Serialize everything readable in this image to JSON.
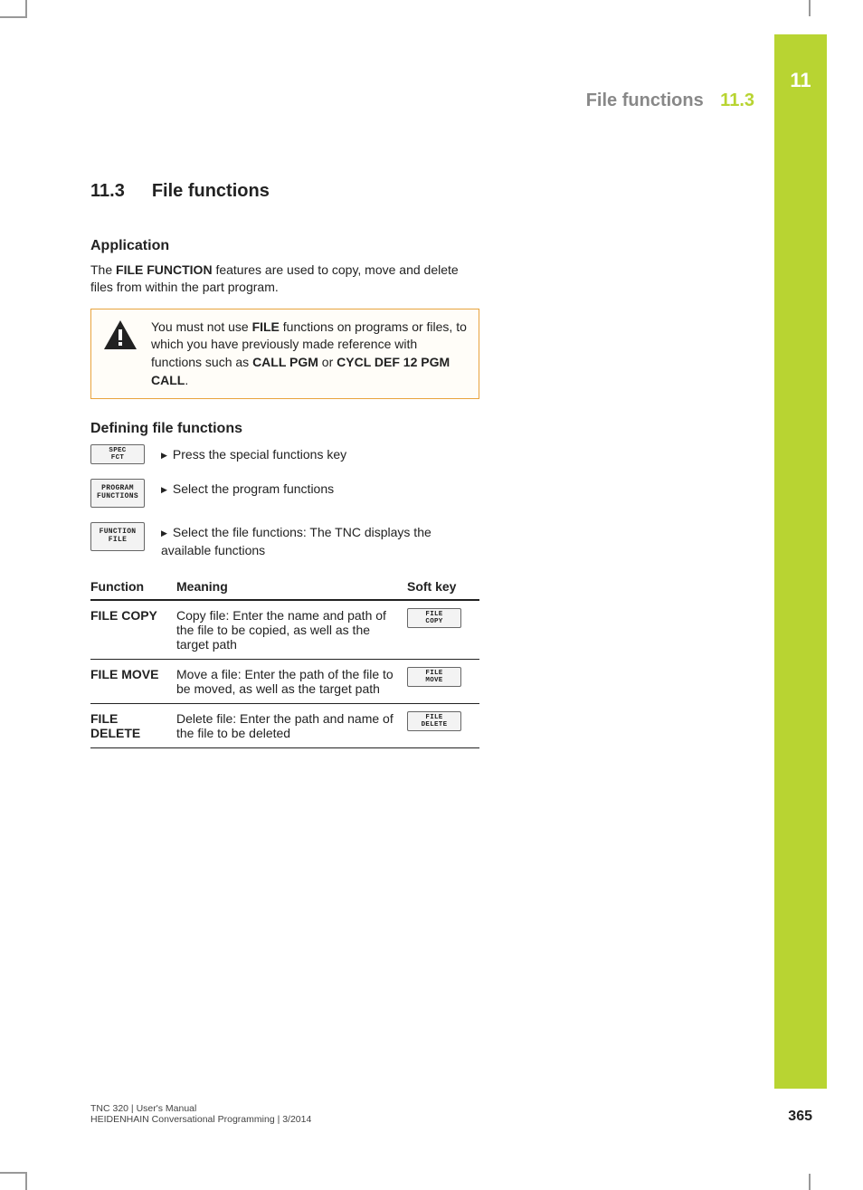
{
  "chapter": {
    "number": "11",
    "section_number": "11.3",
    "section_title": "File functions"
  },
  "running_head": {
    "title": "File functions",
    "num": "11.3"
  },
  "headings": {
    "application": "Application",
    "defining": "Defining file functions"
  },
  "application_text": {
    "pre": "The ",
    "bold1": "FILE FUNCTION",
    "post": " features are used to copy, move and delete files from within the part program."
  },
  "warning": {
    "pre": "You must not use ",
    "bold1": "FILE",
    "mid1": " functions on programs or files, to which you have previously made reference with functions such as ",
    "bold2": "CALL PGM",
    "mid2": " or ",
    "bold3": "CYCL DEF 12 PGM CALL",
    "post": "."
  },
  "steps": [
    {
      "key_line1": "SPEC",
      "key_line2": "FCT",
      "text": "Press the special functions key"
    },
    {
      "key_line1": "PROGRAM",
      "key_line2": "FUNCTIONS",
      "text": "Select the program functions"
    },
    {
      "key_line1": "FUNCTION",
      "key_line2": "FILE",
      "text": "Select the file functions: The TNC displays the available functions"
    }
  ],
  "table": {
    "headers": {
      "c1": "Function",
      "c2": "Meaning",
      "c3": "Soft key"
    },
    "rows": [
      {
        "fn": "FILE COPY",
        "meaning": "Copy file: Enter the name and path of the file to be copied, as well as the target path",
        "sk1": "FILE",
        "sk2": "COPY"
      },
      {
        "fn": "FILE MOVE",
        "meaning": "Move a file: Enter the path of the file to be moved, as well as the target path",
        "sk1": "FILE",
        "sk2": "MOVE"
      },
      {
        "fn": "FILE DELETE",
        "meaning": "Delete file: Enter the path and name of the file to be deleted",
        "sk1": "FILE",
        "sk2": "DELETE"
      }
    ]
  },
  "footer": {
    "line1": "TNC 320 | User's Manual",
    "line2": "HEIDENHAIN Conversational Programming | 3/2014"
  },
  "page_number": "365"
}
